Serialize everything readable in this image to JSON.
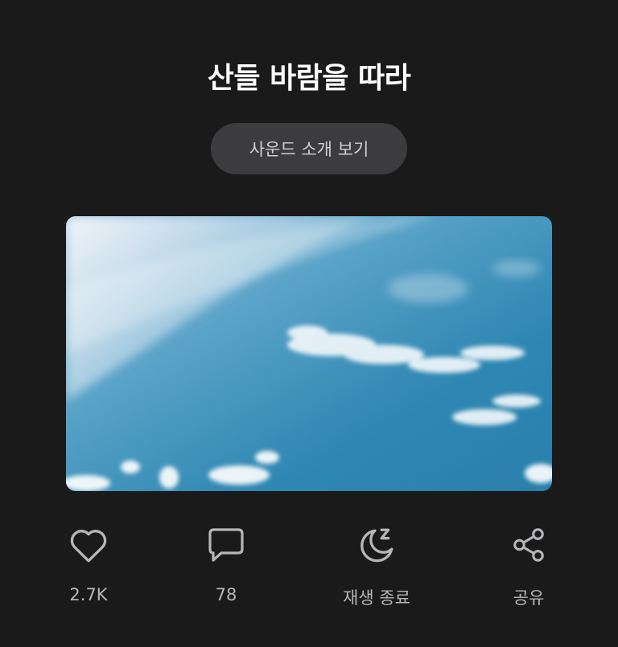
{
  "player": {
    "title": "산들 바람을 따라",
    "intro_button_label": "사운드 소개 보기",
    "artwork_icon": "sky-clouds-image"
  },
  "actions": {
    "like": {
      "icon": "heart-icon",
      "label": "2.7K"
    },
    "comment": {
      "icon": "comment-icon",
      "label": "78"
    },
    "sleep_timer": {
      "icon": "moon-zzz-icon",
      "label": "재생 종료"
    },
    "share": {
      "icon": "share-icon",
      "label": "공유"
    }
  },
  "colors": {
    "background": "#1a1a1b",
    "button_background": "#3c3c3e",
    "icon_color": "#b6b6b9",
    "sky_blue": "#2f87b3"
  }
}
